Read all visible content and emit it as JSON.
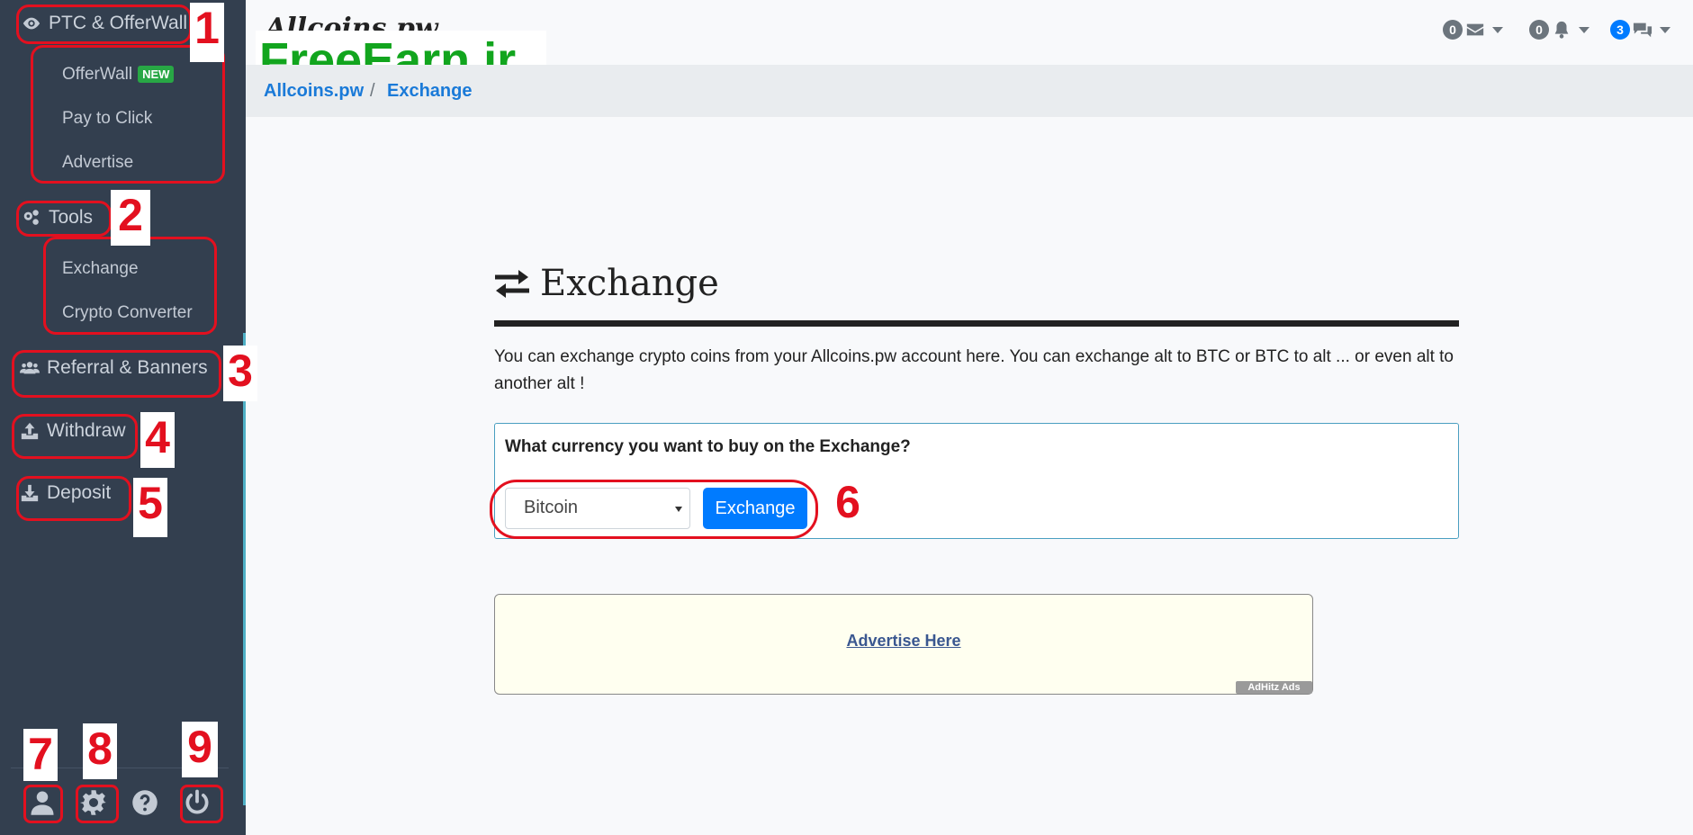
{
  "sidebar": {
    "sections": [
      {
        "label": "PTC & OfferWall",
        "icon": "eye-icon"
      },
      {
        "label": "Tools",
        "icon": "cogs-icon"
      },
      {
        "label": "Referral & Banners",
        "icon": "users-icon"
      },
      {
        "label": "Withdraw",
        "icon": "upload-icon"
      },
      {
        "label": "Deposit",
        "icon": "download-icon"
      }
    ],
    "ptc_items": [
      {
        "label": "OfferWall",
        "badge": "NEW"
      },
      {
        "label": "Pay to Click"
      },
      {
        "label": "Advertise"
      }
    ],
    "tools_items": [
      {
        "label": "Exchange"
      },
      {
        "label": "Crypto Converter"
      }
    ],
    "footer_icons": [
      "user-icon",
      "gear-icon",
      "help-icon",
      "power-icon"
    ]
  },
  "header": {
    "logo": "Allcoins.pw",
    "watermark": "FreeEarn.ir",
    "messages_count": "0",
    "notifications_count": "0",
    "chat_count": "3",
    "colors": {
      "muted_badge": "#6c757d",
      "primary_badge": "#007bff"
    }
  },
  "breadcrumb": {
    "home": "Allcoins.pw",
    "separator": "/",
    "current": "Exchange"
  },
  "main": {
    "title": "Exchange",
    "description": "You can exchange crypto coins from your Allcoins.pw account here. You can exchange alt to BTC or BTC to alt ... or even alt to another alt !",
    "card_question": "What currency you want to buy on the Exchange?",
    "select_value": "Bitcoin",
    "exchange_button": "Exchange"
  },
  "ad": {
    "link": "Advertise Here",
    "tag": "AdHitz Ads"
  },
  "annotations": [
    "1",
    "2",
    "3",
    "4",
    "5",
    "6",
    "7",
    "8",
    "9"
  ]
}
